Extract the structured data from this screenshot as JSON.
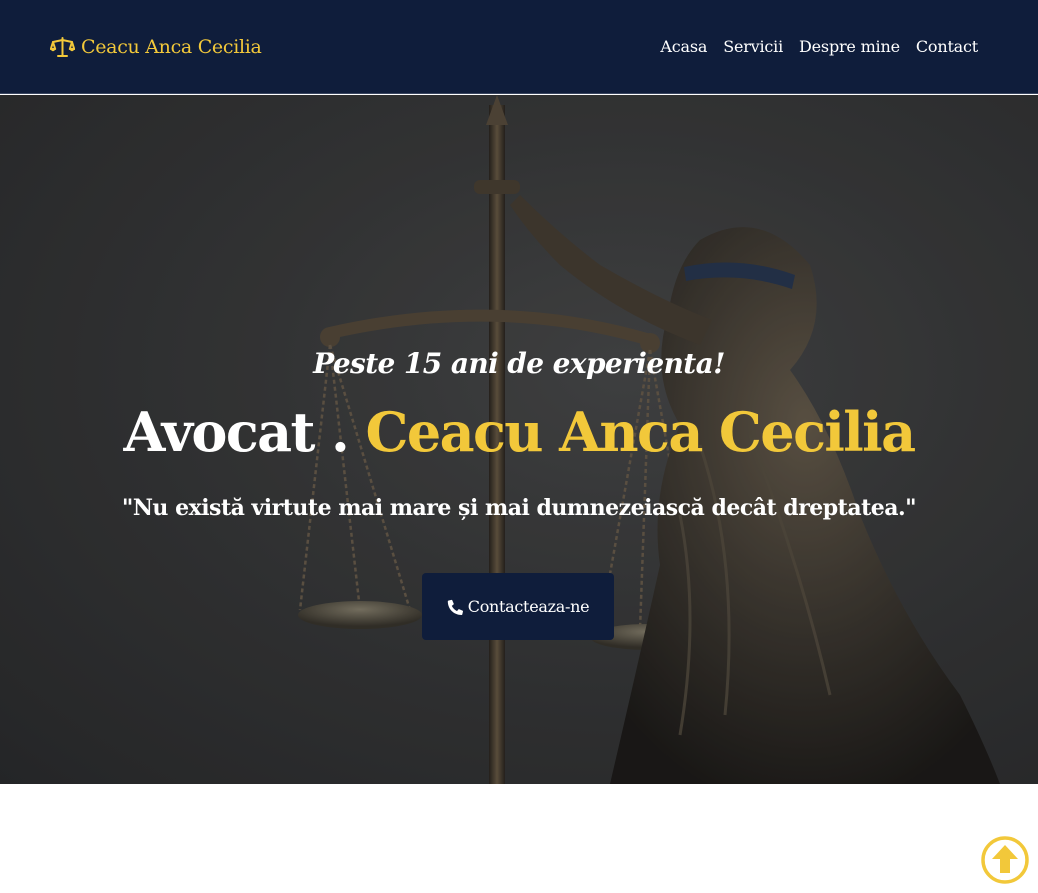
{
  "navbar": {
    "brand": {
      "icon": "scale-balance-icon",
      "name": "Ceacu Anca Cecilia"
    },
    "links": [
      {
        "label": "Acasa"
      },
      {
        "label": "Servicii"
      },
      {
        "label": "Despre mine"
      },
      {
        "label": "Contact"
      }
    ]
  },
  "hero": {
    "tagline": "Peste 15 ani de experienta!",
    "headline_prefix": "Avocat .",
    "headline_name": "Ceacu Anca Cecilia",
    "quote": "\"Nu există virtute mai mare și mai dumnezeiască decât dreptatea.\"",
    "cta": {
      "label": "Contacteaza-ne",
      "icon": "phone-icon"
    }
  },
  "scroll_top": {
    "icon": "arrow-up-circle-icon"
  },
  "colors": {
    "navy": "#0f1d3b",
    "gold": "#f2c83a",
    "white": "#ffffff"
  }
}
